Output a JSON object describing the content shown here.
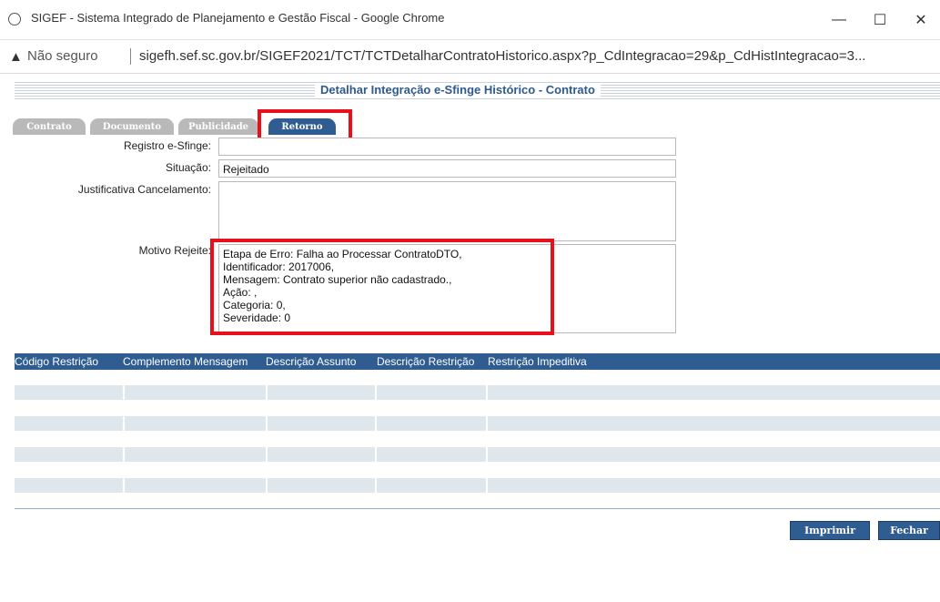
{
  "window": {
    "title": "SIGEF - Sistema Integrado de Planejamento e Gestão Fiscal - Google Chrome"
  },
  "address": {
    "security_label": "Não seguro",
    "url": "sigefh.sef.sc.gov.br/SIGEF2021/TCT/TCTDetalharContratoHistorico.aspx?p_CdIntegracao=29&p_CdHistIntegracao=3..."
  },
  "page": {
    "title": "Detalhar Integração e-Sfinge Histórico - Contrato"
  },
  "tabs": [
    {
      "label": "Contrato"
    },
    {
      "label": "Documento"
    },
    {
      "label": "Publicidade"
    },
    {
      "label": "Retorno",
      "active": true
    }
  ],
  "form": {
    "registro_label": "Registro e-Sfinge:",
    "registro_value": "",
    "situacao_label": "Situação:",
    "situacao_value": "Rejeitado",
    "justificativa_label": "Justificativa Cancelamento:",
    "justificativa_value": "",
    "motivo_label": "Motivo Rejeite:",
    "motivo_value": "Etapa de Erro: Falha ao Processar ContratoDTO,\nIdentificador: 2017006,\nMensagem: Contrato superior não cadastrado.,\nAção: ,\nCategoria: 0,\nSeveridade: 0"
  },
  "table": {
    "headers": [
      "Código Restrição",
      "Complemento Mensagem",
      "Descrição Assunto",
      "Descrição Restrição",
      "Restrição Impeditiva"
    ],
    "rows": [
      [
        "",
        "",
        "",
        "",
        ""
      ],
      [
        "",
        "",
        "",
        "",
        ""
      ],
      [
        "",
        "",
        "",
        "",
        ""
      ],
      [
        "",
        "",
        "",
        "",
        ""
      ]
    ]
  },
  "buttons": {
    "print": "Imprimir",
    "close": "Fechar"
  },
  "colors": {
    "accent": "#2f5d91",
    "highlight": "#e8101a",
    "tab_inactive": "#b9b9b9",
    "row_fill": "#dfe6ec"
  }
}
